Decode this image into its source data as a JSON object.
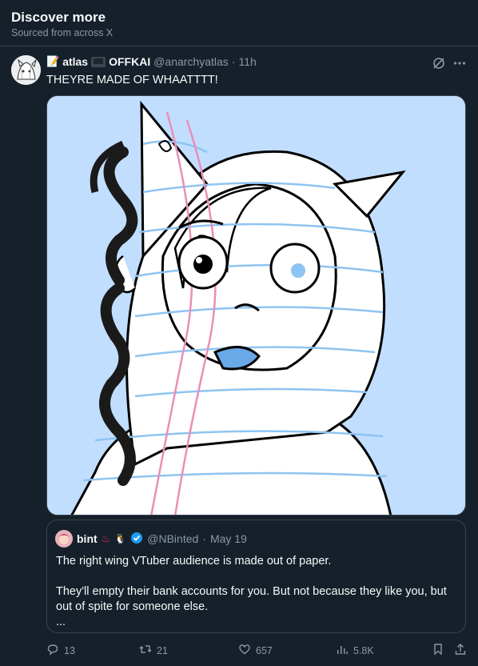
{
  "section": {
    "title": "Discover more",
    "subtitle": "Sourced from across X"
  },
  "tweet": {
    "author_name": "atlas",
    "author_tag": "OFFKAI",
    "handle": "@anarchyatlas",
    "separator": "·",
    "time": "11h",
    "text": "THEYRE MADE OF WHAATTTT!",
    "media_alt_icon": "illustration"
  },
  "quote": {
    "author_name": "bint",
    "handle": "@NBinted",
    "separator": "·",
    "date": "May 19",
    "para1": "The right wing VTuber audience is made out of paper.",
    "para2": "They'll empty their bank accounts for you. But not because they like you, but out of spite for someone else.",
    "para3": "..."
  },
  "actions": {
    "replies": "13",
    "reposts": "21",
    "likes": "657",
    "views": "5.8K"
  },
  "colors": {
    "background": "#15202b",
    "muted": "#8b98a5",
    "border": "#38444d",
    "verified": "#1d9bf0"
  }
}
